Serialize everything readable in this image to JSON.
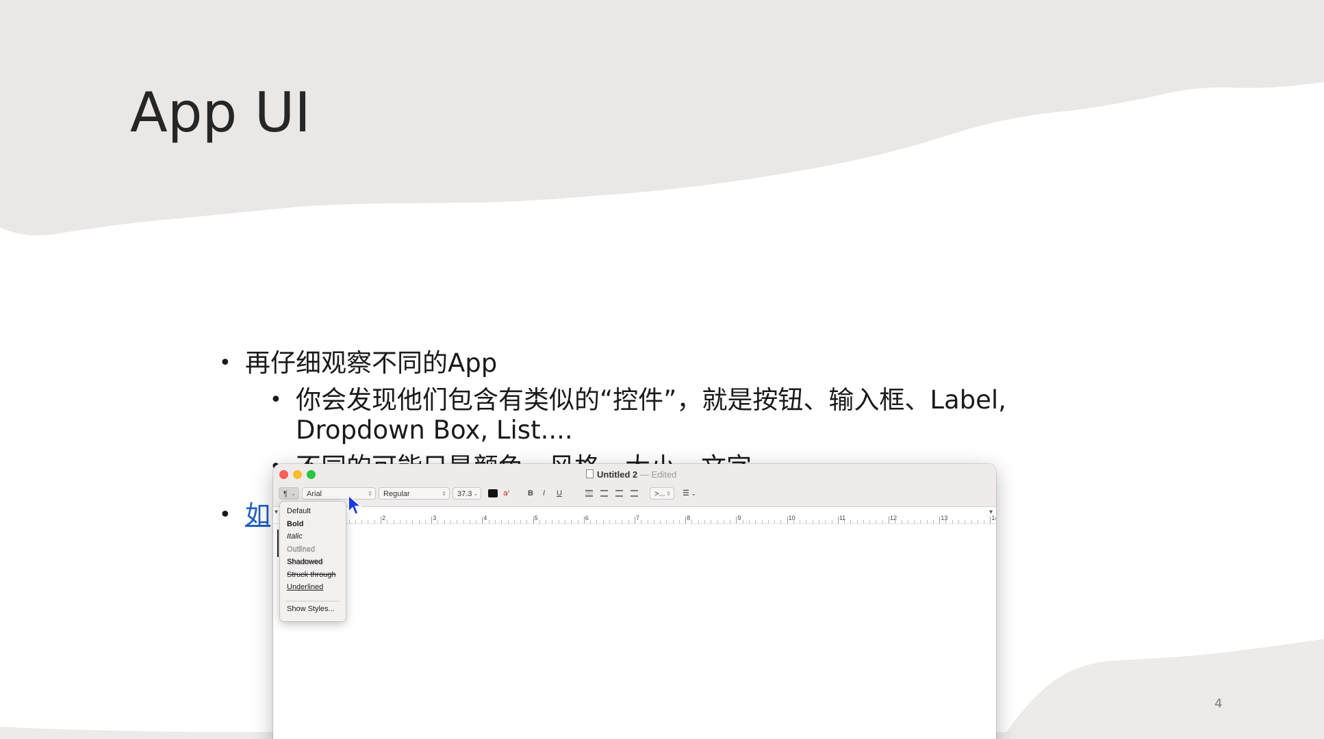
{
  "slide": {
    "title": "App UI",
    "bullets": [
      {
        "level": 1,
        "text": "再仔细观察不同的App"
      },
      {
        "level": 2,
        "text": "你会发现他们包含有类似的“控件”，就是按钮、输入框、Label,"
      },
      {
        "level": 2,
        "text_cont": "Dropdown Box, List...."
      },
      {
        "level": 2,
        "text": "不同的可能只是颜色、风格、大小、文字"
      },
      {
        "level": 1,
        "text": "如",
        "link": true
      }
    ],
    "page_number": "4",
    "colors": {
      "link": "#1f5fbf",
      "paper_top": "#eae8e7",
      "paper_bottom": "#ecebea"
    }
  },
  "window": {
    "title": "Untitled 2",
    "title_sep": " — ",
    "status": "Edited",
    "toolbar": {
      "paragraph_button": "¶",
      "font_family": "Arial",
      "font_style": "Regular",
      "font_size": "37.3",
      "bold_label": "B",
      "italic_label": "I",
      "underline_label": "U",
      "highlight_icon": "a",
      "spacing_label": ">...",
      "list_icon": "list-icon"
    },
    "ruler": [
      "2",
      "3",
      "4",
      "5",
      "6",
      "7",
      "8",
      "9",
      "10",
      "11",
      "12",
      "13",
      "14"
    ]
  },
  "style_menu": {
    "items": [
      "Default",
      "Bold",
      "Italic",
      "Outlined",
      "Shadowed",
      "Struck through",
      "Underlined"
    ],
    "footer": "Show Styles..."
  }
}
